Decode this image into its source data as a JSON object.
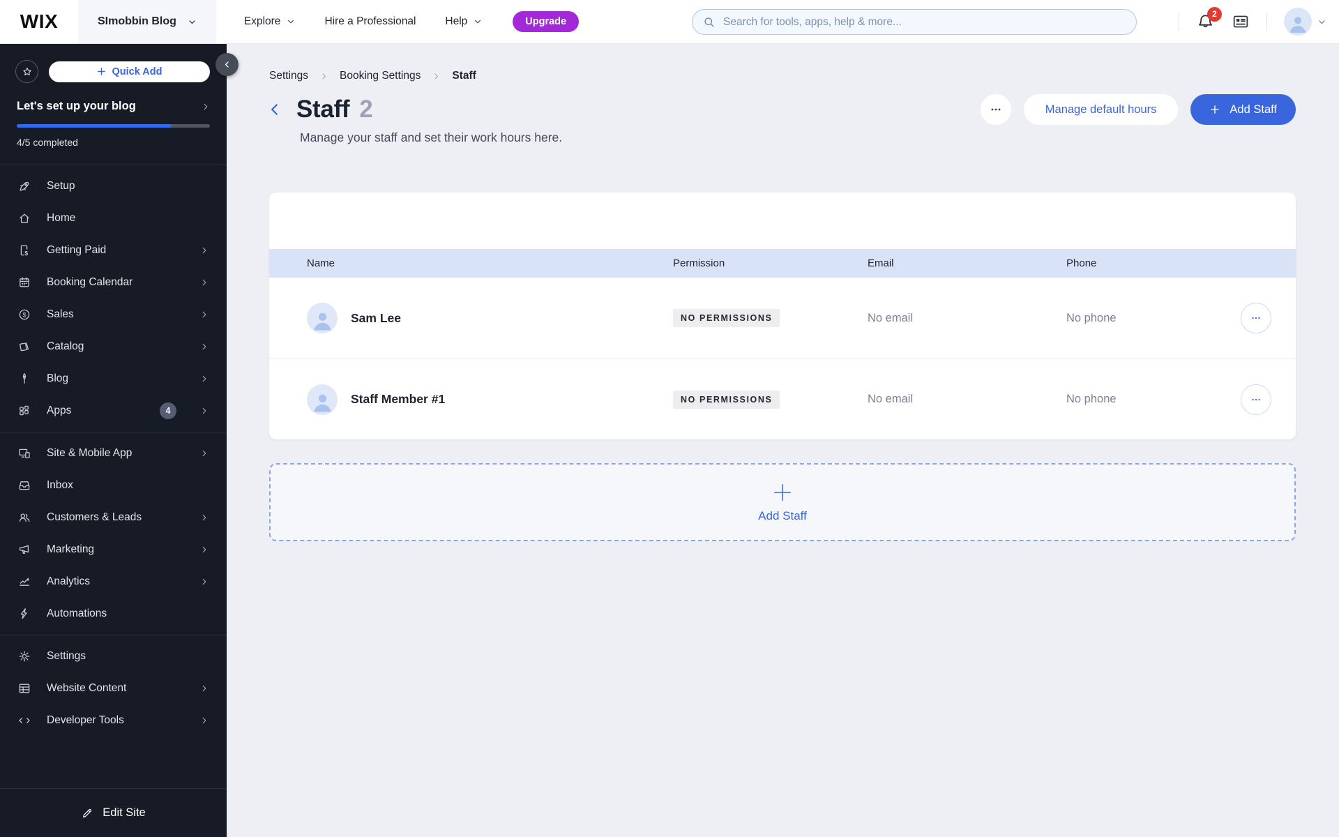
{
  "topbar": {
    "logo": "WIX",
    "site_name": "SImobbin Blog",
    "nav_explore": "Explore",
    "nav_hire": "Hire a Professional",
    "nav_help": "Help",
    "upgrade_label": "Upgrade",
    "search_placeholder": "Search for tools, apps, help & more...",
    "notification_count": "2"
  },
  "sidebar": {
    "quick_add_label": "Quick Add",
    "setup": {
      "title": "Let's set up your blog",
      "completed": "4/5 completed",
      "percent": 80
    },
    "items": [
      {
        "label": "Setup"
      },
      {
        "label": "Home"
      },
      {
        "label": "Getting Paid"
      },
      {
        "label": "Booking Calendar"
      },
      {
        "label": "Sales"
      },
      {
        "label": "Catalog"
      },
      {
        "label": "Blog"
      },
      {
        "label": "Apps",
        "badge": "4"
      },
      {
        "label": "Site & Mobile App"
      },
      {
        "label": "Inbox"
      },
      {
        "label": "Customers & Leads"
      },
      {
        "label": "Marketing"
      },
      {
        "label": "Analytics"
      },
      {
        "label": "Automations"
      },
      {
        "label": "Settings"
      },
      {
        "label": "Website Content"
      },
      {
        "label": "Developer Tools"
      }
    ],
    "edit_site_label": "Edit Site"
  },
  "breadcrumb": {
    "items": [
      "Settings",
      "Booking Settings",
      "Staff"
    ]
  },
  "page": {
    "title": "Staff",
    "count": "2",
    "subtitle": "Manage your staff and set their work hours here.",
    "manage_hours_label": "Manage default hours",
    "add_staff_label": "Add Staff"
  },
  "table": {
    "columns": {
      "name": "Name",
      "permission": "Permission",
      "email": "Email",
      "phone": "Phone"
    },
    "rows": [
      {
        "name": "Sam Lee",
        "permission": "NO PERMISSIONS",
        "email": "No email",
        "phone": "No phone"
      },
      {
        "name": "Staff Member #1",
        "permission": "NO PERMISSIONS",
        "email": "No email",
        "phone": "No phone"
      }
    ]
  },
  "add_staff_box": {
    "label": "Add Staff"
  },
  "colors": {
    "accent_blue": "#3a66dd",
    "sidebar_bg": "#171b26",
    "table_header_bg": "#d9e3f7",
    "upgrade_purple": "#a228d8",
    "notification_red": "#e13b30",
    "main_bg": "#edeff4"
  }
}
